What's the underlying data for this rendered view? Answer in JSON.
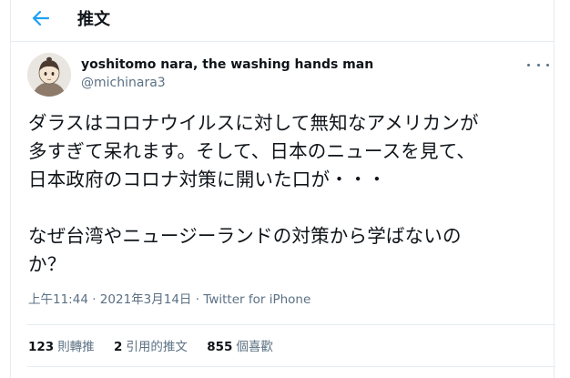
{
  "header": {
    "title": "推文",
    "back_icon": "arrow-left-icon",
    "accent_color": "#1da1f2"
  },
  "tweet": {
    "author": {
      "name": "yoshitomo nara, the washing hands man",
      "handle": "@michinara3"
    },
    "text": "ダラスはコロナウイルスに対して無知なアメリカンが\n多すぎて呆れます。そして、日本のニュースを見て、\n日本政府のコロナ対策に開いた口が・・・\n\nなぜ台湾やニュージーランドの対策から学ばないの\nか？",
    "time": "上午11:44",
    "separator": "·",
    "date": "2021年3月14日",
    "source": "Twitter for iPhone",
    "stats": [
      {
        "count": "123",
        "label": "則轉推"
      },
      {
        "count": "2",
        "label": "引用的推文"
      },
      {
        "count": "855",
        "label": "個喜歡"
      }
    ],
    "more_icon": "more-options-icon"
  }
}
